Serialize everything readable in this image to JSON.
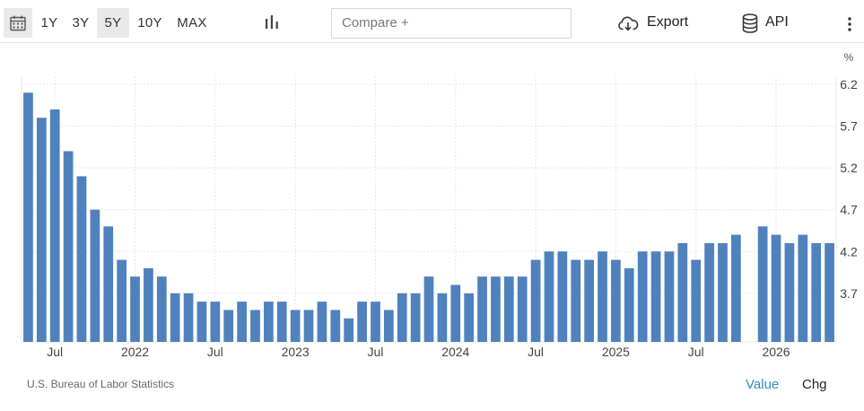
{
  "toolbar": {
    "ranges": [
      "1Y",
      "3Y",
      "5Y",
      "10Y",
      "MAX"
    ],
    "active_range": "5Y",
    "compare_placeholder": "Compare +",
    "export_label": "Export",
    "api_label": "API",
    "icons": {
      "calendar": "calendar-icon",
      "chart_type": "bar-chart-icon",
      "export": "cloud-download-icon",
      "api": "database-icon",
      "more": "vertical-dots-icon"
    }
  },
  "chart_data": {
    "type": "bar",
    "unit_label": "%",
    "bar_color": "#4f81bd",
    "grid": true,
    "ylim": [
      3.0,
      6.2
    ],
    "y_ticks": [
      3.7,
      4.2,
      4.7,
      5.2,
      5.7,
      6.2
    ],
    "x_tick_labels": [
      {
        "label": "Jul",
        "index": 2
      },
      {
        "label": "2022",
        "index": 8
      },
      {
        "label": "Jul",
        "index": 14
      },
      {
        "label": "2023",
        "index": 20
      },
      {
        "label": "Jul",
        "index": 26
      },
      {
        "label": "2024",
        "index": 32
      },
      {
        "label": "Jul",
        "index": 38
      },
      {
        "label": "2025",
        "index": 44
      },
      {
        "label": "Jul",
        "index": 50
      },
      {
        "label": "2026",
        "index": 56
      }
    ],
    "values": [
      6.1,
      5.8,
      5.9,
      5.4,
      5.1,
      4.7,
      4.5,
      4.1,
      3.9,
      4.0,
      3.9,
      3.7,
      3.7,
      3.6,
      3.6,
      3.5,
      3.6,
      3.5,
      3.6,
      3.6,
      3.5,
      3.5,
      3.6,
      3.5,
      3.4,
      3.6,
      3.6,
      3.5,
      3.7,
      3.7,
      3.9,
      3.7,
      3.8,
      3.7,
      3.9,
      3.9,
      3.9,
      3.9,
      4.1,
      4.2,
      4.2,
      4.1,
      4.1,
      4.2,
      4.1,
      4.0,
      4.2,
      4.2,
      4.2,
      4.3,
      4.1,
      4.3,
      4.3,
      4.4,
      null,
      4.5,
      4.4,
      4.3,
      4.4,
      4.3,
      4.3
    ]
  },
  "footer": {
    "source": "U.S. Bureau of Labor Statistics",
    "value_tab": "Value",
    "chg_tab": "Chg"
  }
}
